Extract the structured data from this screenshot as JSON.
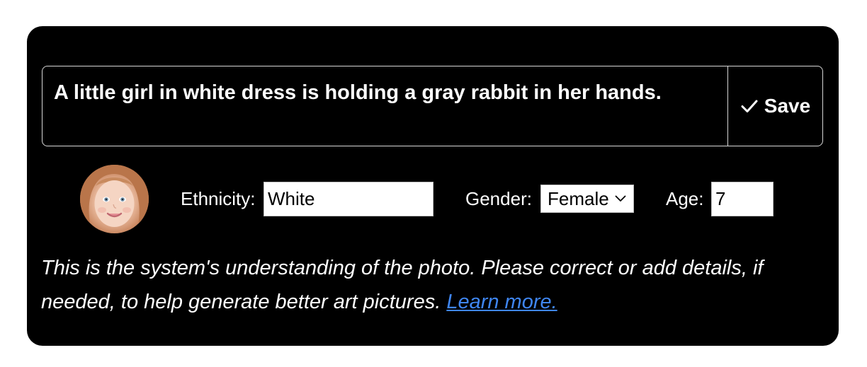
{
  "caption": {
    "text": "A little girl in white dress is holding a gray rabbit in her hands."
  },
  "save_button": {
    "label": "Save",
    "icon": "check-icon"
  },
  "avatar": {
    "description_icon": "avatar"
  },
  "fields": {
    "ethnicity_label": "Ethnicity:",
    "ethnicity_value": "White",
    "gender_label": "Gender:",
    "gender_value": "Female",
    "age_label": "Age:",
    "age_value": "7"
  },
  "note": {
    "text": "This is the system's understanding of the photo. Please correct or add details, if needed, to help generate better art pictures. ",
    "link_label": "Learn more."
  },
  "colors": {
    "panel_bg": "#000000",
    "link": "#3f86f2",
    "border": "#d8d8d8"
  }
}
